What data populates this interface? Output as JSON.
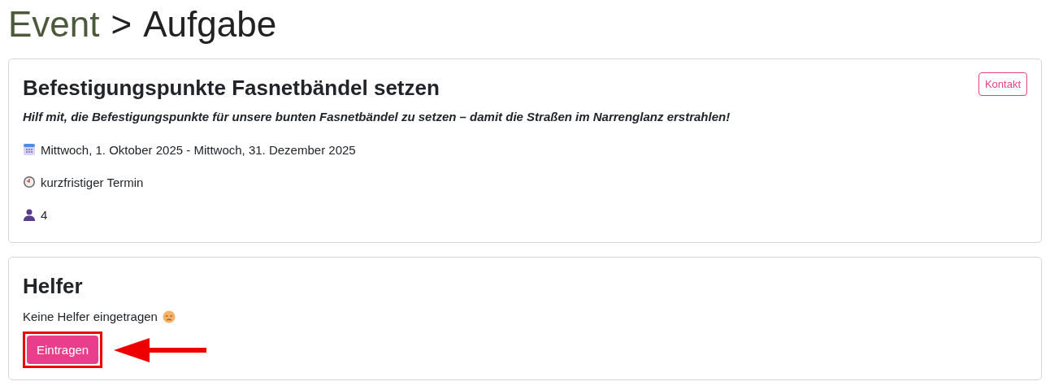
{
  "breadcrumb": [
    {
      "label": "Event",
      "kind": "link"
    },
    {
      "label": ">",
      "kind": "separator"
    },
    {
      "label": "Aufgabe",
      "kind": "current"
    }
  ],
  "task": {
    "title": "Befestigungspunkte Fasnetbändel setzen",
    "subtitle": "Hilf mit, die Befestigungspunkte für unsere bunten Fasnetbändel zu setzen – damit die Straßen im Narrenglanz erstrahlen!",
    "contact_button": "Kontakt",
    "details": [
      {
        "kind": "date",
        "text": "Mittwoch, 1. Oktober 2025 - Mittwoch, 31. Dezember 2025"
      },
      {
        "kind": "time",
        "text": "kurzfristiger Termin"
      },
      {
        "kind": "people",
        "text": "4"
      }
    ]
  },
  "helpers": {
    "title": "Helfer",
    "message": "Keine Helfer eingetragen",
    "button": "Eintragen"
  }
}
